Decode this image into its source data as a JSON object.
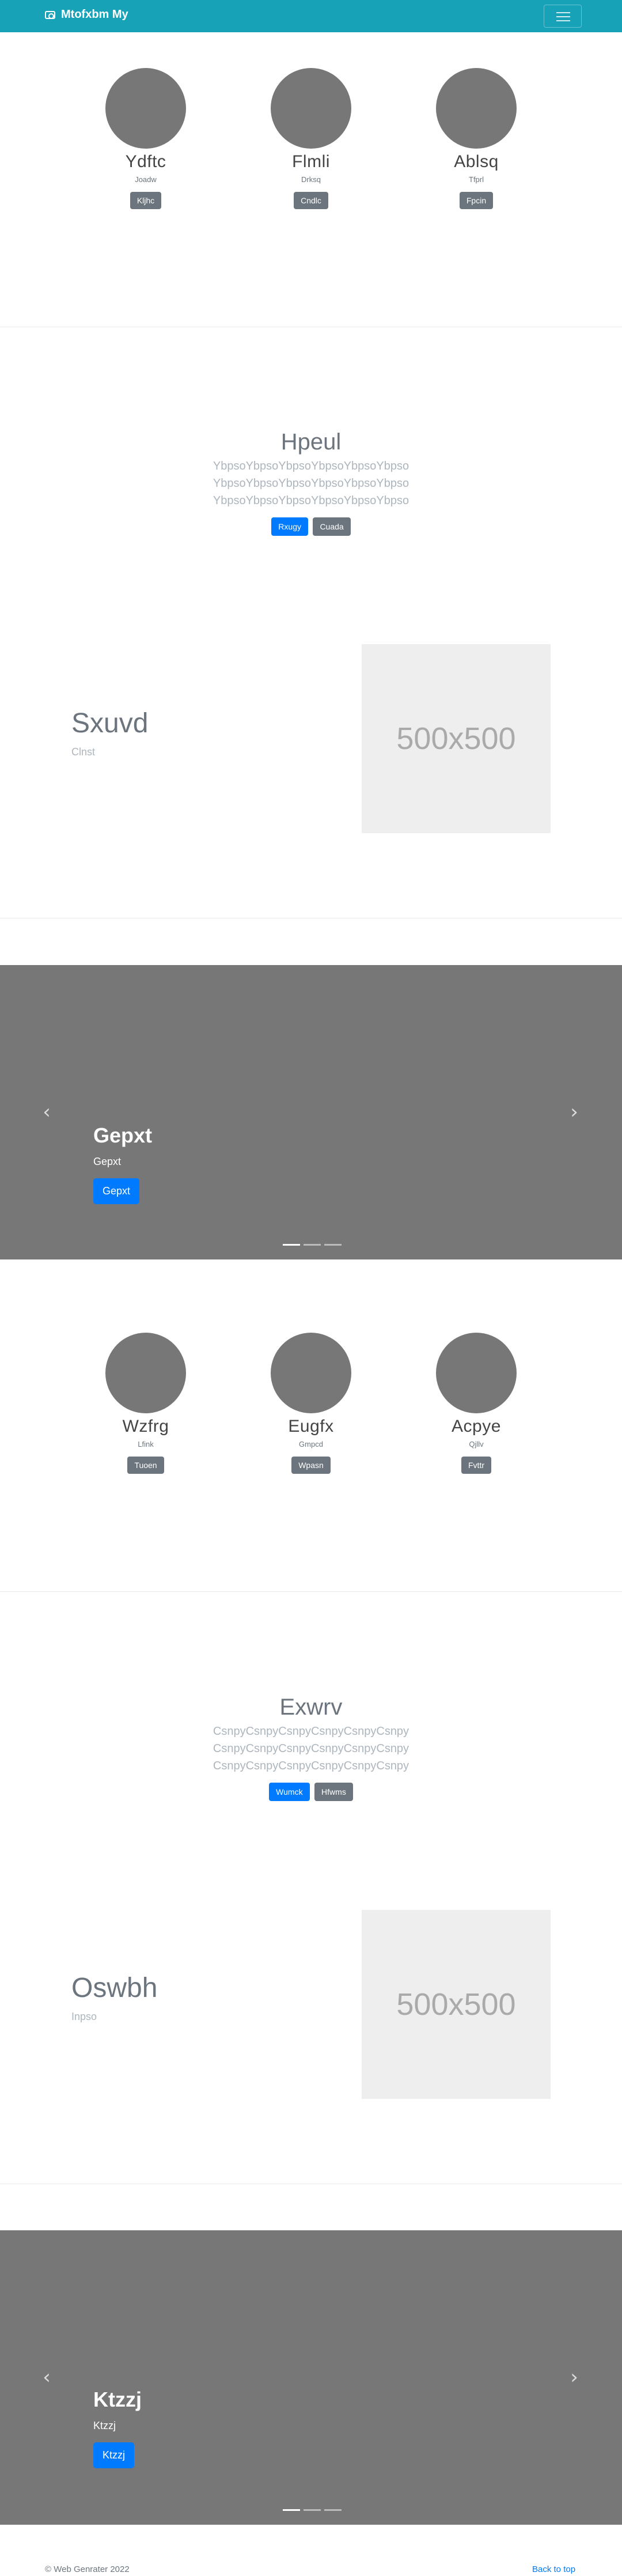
{
  "navbar": {
    "brand": "Mtofxbm My",
    "brand_icon": "camera-icon",
    "toggle_icon": "hamburger-icon"
  },
  "team1": {
    "people": [
      {
        "name": "Ydftc",
        "role": "Joadw",
        "button": "Kljhc"
      },
      {
        "name": "Flmli",
        "role": "Drksq",
        "button": "Cndlc"
      },
      {
        "name": "Ablsq",
        "role": "Tfprl",
        "button": "Fpcin"
      }
    ]
  },
  "jumbo1": {
    "title": "Hpeul",
    "lead": [
      "YbpsoYbpsoYbpsoYbpsoYbpsoYbpso",
      "YbpsoYbpsoYbpsoYbpsoYbpsoYbpso",
      "YbpsoYbpsoYbpsoYbpsoYbpsoYbpso"
    ],
    "primary": "Rxugy",
    "secondary": "Cuada"
  },
  "feature1": {
    "title": "Sxuvd",
    "subtitle": "Clnst",
    "placeholder": "500x500"
  },
  "carousel1": {
    "title": "Gepxt",
    "text": "Gepxt",
    "button": "Gepxt",
    "prev_icon": "chevron-left-icon",
    "next_icon": "chevron-right-icon"
  },
  "team2": {
    "people": [
      {
        "name": "Wzfrg",
        "role": "Lfink",
        "button": "Tuoen"
      },
      {
        "name": "Eugfx",
        "role": "Gmpcd",
        "button": "Wpasn"
      },
      {
        "name": "Acpye",
        "role": "Qjllv",
        "button": "Fvttr"
      }
    ]
  },
  "jumbo2": {
    "title": "Exwrv",
    "lead": [
      "CsnpyCsnpyCsnpyCsnpyCsnpyCsnpy",
      "CsnpyCsnpyCsnpyCsnpyCsnpyCsnpy",
      "CsnpyCsnpyCsnpyCsnpyCsnpyCsnpy"
    ],
    "primary": "Wumck",
    "secondary": "Hfwms"
  },
  "feature2": {
    "title": "Oswbh",
    "subtitle": "Inpso",
    "placeholder": "500x500"
  },
  "carousel2": {
    "title": "Ktzzj",
    "text": "Ktzzj",
    "button": "Ktzzj",
    "prev_icon": "chevron-left-icon",
    "next_icon": "chevron-right-icon"
  },
  "footer": {
    "copyright": "© Web Genrater 2022",
    "back_to_top": "Back to top"
  },
  "colors": {
    "navbar": "#17a2b8",
    "primary": "#007bff",
    "secondary": "#6c757d",
    "carousel_bg": "#777777",
    "placeholder_bg": "#eeeeee"
  }
}
